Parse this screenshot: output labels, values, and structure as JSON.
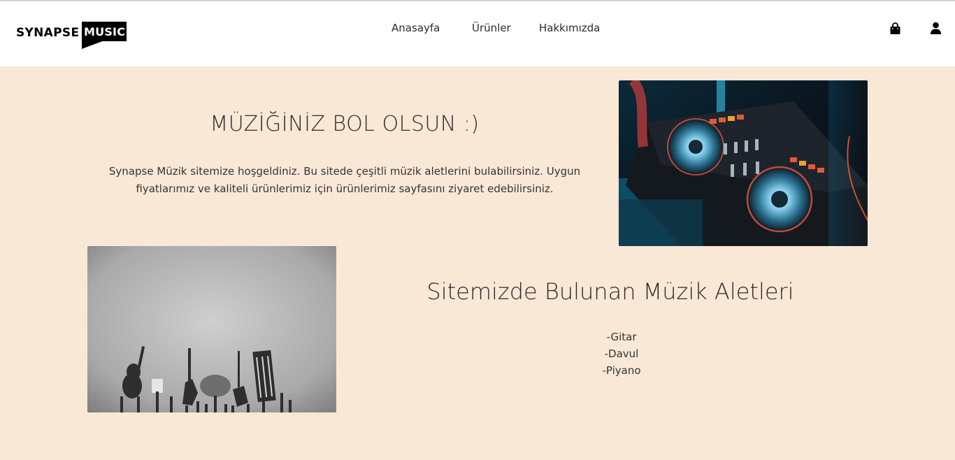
{
  "brand": {
    "word1": "SYNAPSE",
    "word2": "MUSIC"
  },
  "nav": {
    "items": [
      "Anasayfa",
      "Ürünler",
      "Hakkımızda"
    ]
  },
  "header_icons": {
    "cart": "shopping-bag-icon",
    "account": "user-icon"
  },
  "hero": {
    "title": "MÜZİĞİNİZ BOL OLSUN :)",
    "text": "Synapse Müzik sitemize hoşgeldiniz. Bu sitede çeşitli müzik aletlerini bulabilirsiniz. Uygun fiyatlarımız ve kaliteli ürünlerimiz için ürünlerimiz sayfasını ziyaret edebilirsiniz."
  },
  "instruments": {
    "title": "Sitemizde Bulunan Müzik Aletleri",
    "items": [
      "-Gitar",
      "-Davul",
      "-Piyano"
    ]
  },
  "colors": {
    "background": "#f9e8d6",
    "header": "#ffffff",
    "text": "#2b2b2b"
  }
}
